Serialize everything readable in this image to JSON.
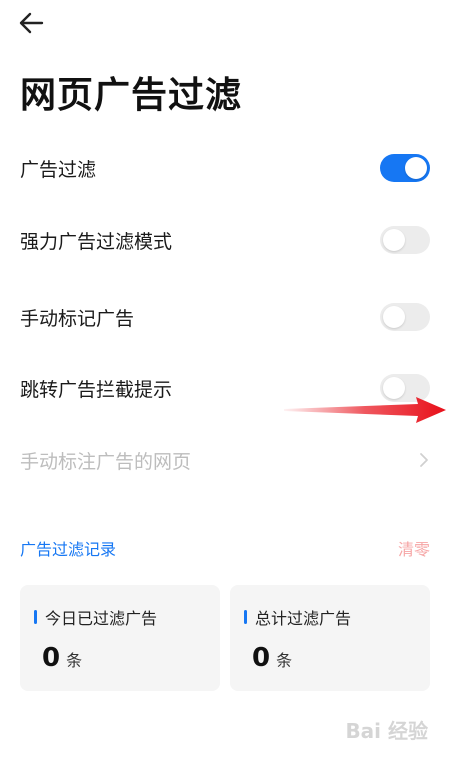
{
  "header": {
    "title": "网页广告过滤"
  },
  "settings": [
    {
      "label": "广告过滤",
      "toggle": true
    },
    {
      "label": "强力广告过滤模式",
      "toggle": false
    },
    {
      "label": "手动标记广告",
      "toggle": false
    },
    {
      "label": "跳转广告拦截提示",
      "toggle": false
    }
  ],
  "manual_page": {
    "label": "手动标注广告的网页"
  },
  "records": {
    "title": "广告过滤记录",
    "clear_label": "清零",
    "today": {
      "label": "今日已过滤广告",
      "value": "0",
      "unit": "条"
    },
    "total": {
      "label": "总计过滤广告",
      "value": "0",
      "unit": "条"
    }
  },
  "colors": {
    "accent": "#1677f3",
    "clear": "#f6a5a5",
    "arrow": "#e8101a"
  },
  "watermark": {
    "text": "Bai 经验"
  }
}
